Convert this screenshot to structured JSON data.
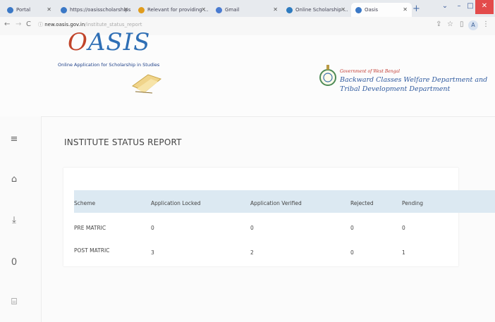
{
  "browser": {
    "tabs": [
      {
        "label": "Portal",
        "color": "#3b78c6"
      },
      {
        "label": "https://oasisscholarships ...",
        "color": "#3b78c6"
      },
      {
        "label": "Relevant for providing ...",
        "color": "#e09c1d"
      },
      {
        "label": "Gmail",
        "color": "#4a7bd0"
      },
      {
        "label": "Online Scholarship ...",
        "color": "#2e7bbf"
      },
      {
        "label": "Oasis",
        "color": "#3b78c6",
        "active": true
      }
    ],
    "url_host": "new.oasis.gov.in",
    "url_path": "/institute_status_report"
  },
  "header": {
    "logo_text_a": "O",
    "logo_text_b": "ASIS",
    "logo_tagline": "Online Application for Scholarship in Studies",
    "gov_line": "Government of West Bengal",
    "dept_line1": "Backward Classes Welfare Department and",
    "dept_line2": "Tribal Development Department"
  },
  "sidebar": {
    "items": [
      "menu-icon",
      "home-icon",
      "download-icon",
      "info-icon",
      "building-icon"
    ]
  },
  "main": {
    "title": "INSTITUTE STATUS REPORT",
    "table": {
      "headers": [
        "Scheme",
        "Application Locked",
        "Application Verified",
        "Rejected",
        "Pending"
      ],
      "rows": [
        [
          "PRE MATRIC",
          "0",
          "0",
          "0",
          "0"
        ],
        [
          "POST MATRIC",
          "3",
          "2",
          "0",
          "1"
        ]
      ]
    }
  }
}
